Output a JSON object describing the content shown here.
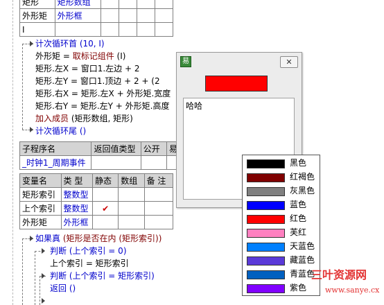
{
  "top_table": {
    "rows": [
      [
        "矩形",
        "矩形数组",
        "",
        "",
        "",
        ""
      ],
      [
        "外形矩",
        "外形框",
        "",
        "",
        "",
        ""
      ],
      [
        "I",
        "",
        "",
        "",
        "",
        ""
      ]
    ]
  },
  "code_lines": {
    "loop_start": "计次循环首 (10, I)",
    "l1_a": "外形矩 = ",
    "l1_b": "取标记组件",
    "l1_c": " (I)",
    "l2": "矩形.左X = 窗口1.左边 + 2",
    "l3": "矩形.左Y = 窗口1.顶边 + 2 + (2",
    "l4": "矩形.右X = 矩形.左X + 外形矩.宽度",
    "l5": "矩形.右Y = 矩形.左Y + 外形矩.高度",
    "l6_a": "加入成员",
    "l6_b": " (矩形数组, 矩形)",
    "loop_end": "计次循环尾 ()"
  },
  "sub_table": {
    "headers": [
      "子程序名",
      "返回值类型",
      "公开",
      "易"
    ],
    "row": [
      "_时钟1_周期事件",
      "",
      "",
      ""
    ]
  },
  "var_table": {
    "headers": [
      "变量名",
      "类 型",
      "静态",
      "数组",
      "备 注"
    ],
    "rows": [
      [
        "矩形索引",
        "整数型",
        "",
        "",
        ""
      ],
      [
        "上个索引",
        "整数型",
        "✔",
        "",
        ""
      ],
      [
        "外形矩",
        "外形框",
        "",
        "",
        ""
      ]
    ]
  },
  "code2": {
    "if_a": "如果真",
    "if_b": " (矩形是否在内 (矩形索引))",
    "j1": "判断 (上个索引 = 0)",
    "a1": "上个索引 = 矩形索引",
    "j2": "判断 (上个索引 = 矩形索引)",
    "ret": "返回 ()"
  },
  "dialog": {
    "close_glyph": "✕",
    "icon_glyph": "易",
    "text": "哈哈"
  },
  "colors": [
    {
      "name": "黑色",
      "hex": "#000000"
    },
    {
      "name": "红褐色",
      "hex": "#800000"
    },
    {
      "name": "灰黑色",
      "hex": "#808080"
    },
    {
      "name": "蓝色",
      "hex": "#0000ff"
    },
    {
      "name": "红色",
      "hex": "#ff0000"
    },
    {
      "name": "芙红",
      "hex": "#ff80c0"
    },
    {
      "name": "天蓝色",
      "hex": "#0080ff"
    },
    {
      "name": "藏蓝色",
      "hex": "#5a3ad8"
    },
    {
      "name": "青蓝色",
      "hex": "#0060c0"
    },
    {
      "name": "紫色",
      "hex": "#8000ff"
    }
  ],
  "watermark": {
    "cn": "三叶资源网",
    "url": "www.sanye.cx"
  }
}
